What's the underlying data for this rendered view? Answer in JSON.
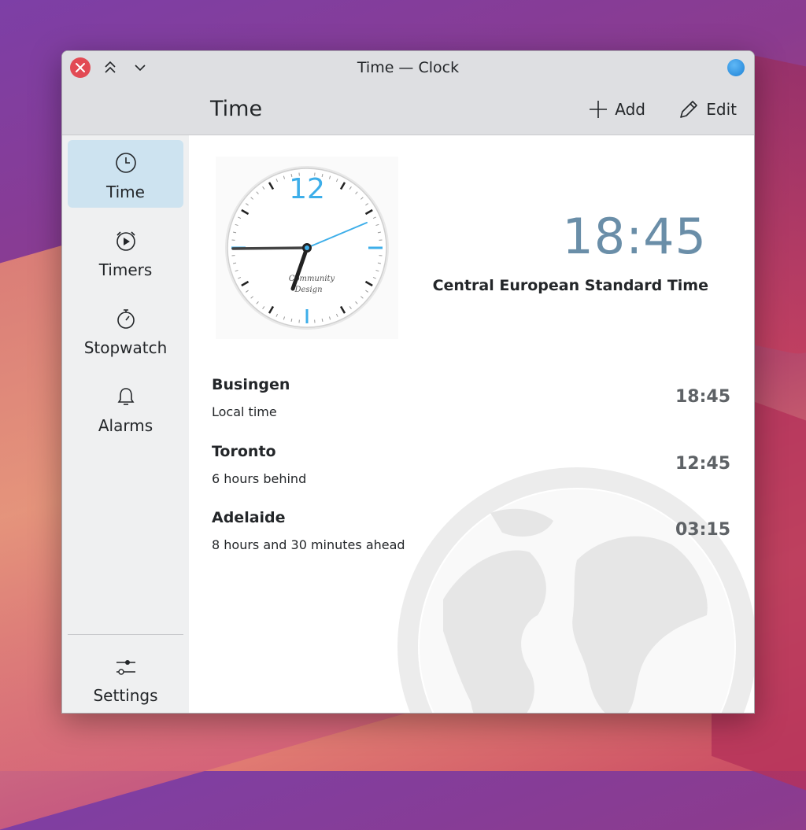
{
  "window": {
    "title": "Time — Clock"
  },
  "header": {
    "page_title": "Time",
    "add_label": "Add",
    "edit_label": "Edit"
  },
  "sidebar": {
    "items": [
      {
        "label": "Time",
        "icon": "clock-icon",
        "active": true
      },
      {
        "label": "Timers",
        "icon": "timer-icon",
        "active": false
      },
      {
        "label": "Stopwatch",
        "icon": "stopwatch-icon",
        "active": false
      },
      {
        "label": "Alarms",
        "icon": "bell-icon",
        "active": false
      }
    ],
    "settings_label": "Settings"
  },
  "clock": {
    "current_time": "18:45",
    "timezone": "Central European Standard Time",
    "face_number": "12",
    "face_brand_line1": "Community",
    "face_brand_line2": "Design"
  },
  "cities": [
    {
      "name": "Busingen",
      "desc": "Local time",
      "time": "18:45"
    },
    {
      "name": "Toronto",
      "desc": "6 hours behind",
      "time": "12:45"
    },
    {
      "name": "Adelaide",
      "desc": "8 hours and 30 minutes ahead",
      "time": "03:15"
    }
  ],
  "colors": {
    "accent": "#3daee9",
    "active_nav": "#cde3f0",
    "big_time": "#6a8ea8",
    "close": "#e24a54"
  }
}
